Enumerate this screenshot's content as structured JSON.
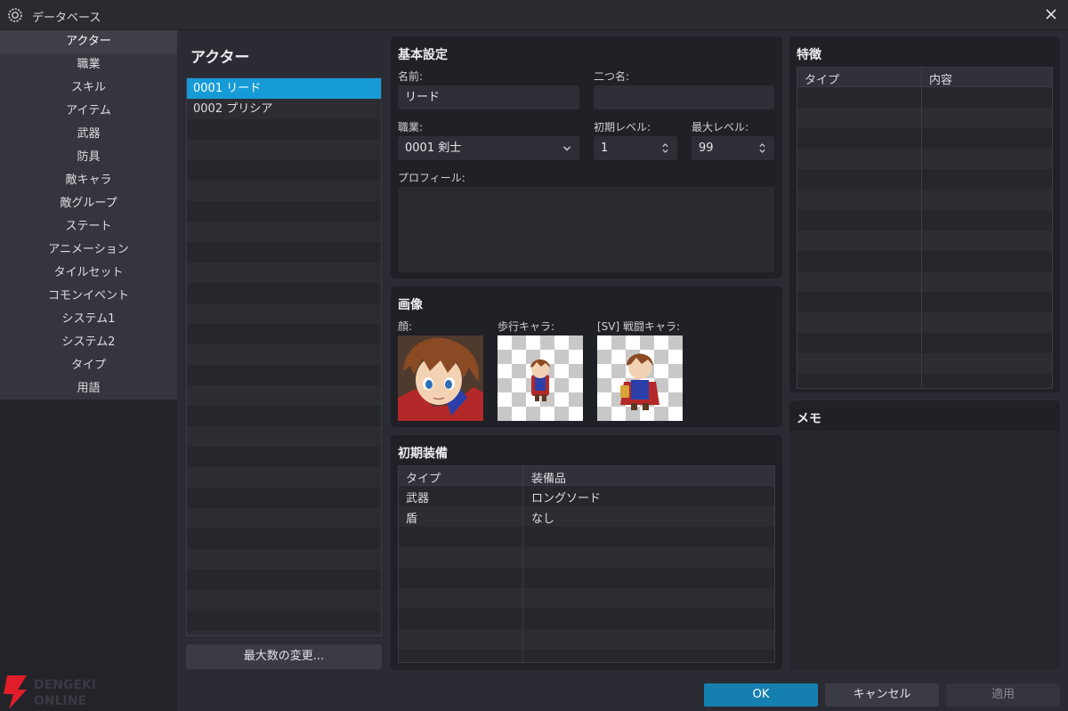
{
  "window": {
    "title": "データベース",
    "icon": "gear-icon",
    "close_icon": "close-icon"
  },
  "sidebar": {
    "items": [
      {
        "label": "アクター",
        "active": true
      },
      {
        "label": "職業"
      },
      {
        "label": "スキル"
      },
      {
        "label": "アイテム"
      },
      {
        "label": "武器"
      },
      {
        "label": "防具"
      },
      {
        "label": "敵キャラ"
      },
      {
        "label": "敵グループ"
      },
      {
        "label": "ステート"
      },
      {
        "label": "アニメーション"
      },
      {
        "label": "タイルセット"
      },
      {
        "label": "コモンイベント"
      },
      {
        "label": "システム1"
      },
      {
        "label": "システム2"
      },
      {
        "label": "タイプ"
      },
      {
        "label": "用語"
      }
    ]
  },
  "actor_list": {
    "heading": "アクター",
    "items": [
      "0001 リード",
      "0002 プリシア"
    ],
    "selected_index": 0,
    "change_max_label": "最大数の変更..."
  },
  "basic": {
    "title": "基本設定",
    "name_label": "名前:",
    "name_value": "リード",
    "nickname_label": "二つ名:",
    "nickname_value": "",
    "class_label": "職業:",
    "class_value": "0001 剣士",
    "initial_level_label": "初期レベル:",
    "initial_level_value": "1",
    "max_level_label": "最大レベル:",
    "max_level_value": "99",
    "profile_label": "プロフィール:"
  },
  "images": {
    "title": "画像",
    "face_label": "顔:",
    "walk_label": "歩行キャラ:",
    "battler_label": "[SV] 戦闘キャラ:"
  },
  "equipment": {
    "title": "初期装備",
    "col_type": "タイプ",
    "col_item": "装備品",
    "rows": [
      {
        "type": "武器",
        "item": "ロングソード"
      },
      {
        "type": "盾",
        "item": "なし"
      }
    ]
  },
  "traits": {
    "title": "特徴",
    "col_type": "タイプ",
    "col_content": "内容"
  },
  "memo": {
    "title": "メモ"
  },
  "buttons": {
    "ok": "OK",
    "cancel": "キャンセル",
    "apply": "適用"
  },
  "watermark": {
    "line1": "DENGEKI",
    "line2": "ONLINE"
  },
  "colors": {
    "accent": "#169bd7",
    "ok_button": "#157fb0",
    "panel": "#202027"
  }
}
